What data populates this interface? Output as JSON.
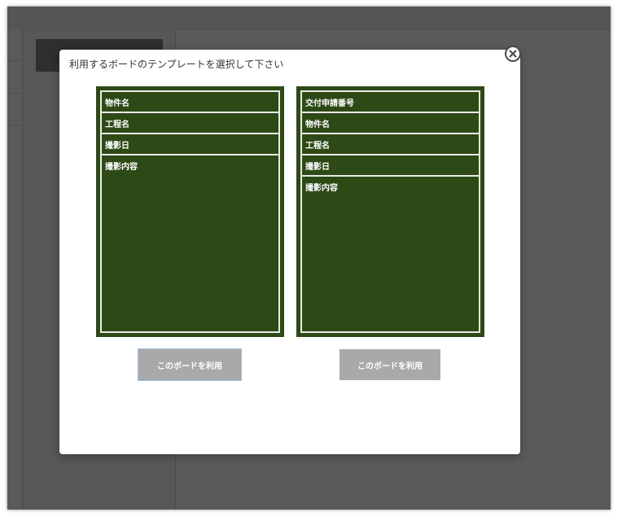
{
  "modal": {
    "title": "利用するボードのテンプレートを選択して下さい",
    "close_icon": "close-circle-x-icon"
  },
  "boards": [
    {
      "rows": [
        "物件名",
        "工程名",
        "撮影日",
        "撮影内容"
      ],
      "button_label": "このボードを利用"
    },
    {
      "rows": [
        "交付申請番号",
        "物件名",
        "工程名",
        "撮影日",
        "撮影内容"
      ],
      "button_label": "このボードを利用"
    }
  ],
  "colors": {
    "board_green": "#2d4a16",
    "board_line": "#e9e9e9",
    "button_gray": "#a9a9a9",
    "overlay": "#5a5a5a"
  }
}
